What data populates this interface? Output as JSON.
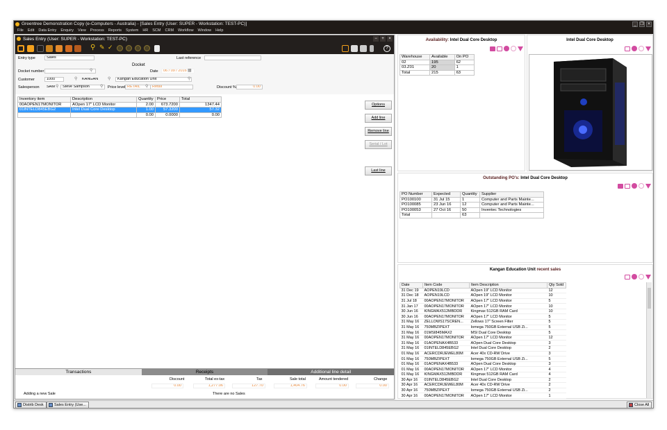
{
  "app": {
    "title": "Greentree Demonstration Copy (e-Computers - Australia) - [Sales Entry (User: SUPER - Workstation: TEST-PC)]"
  },
  "menu": [
    "File",
    "Edit",
    "Data Entry",
    "Enquiry",
    "View",
    "Process",
    "Reports",
    "System",
    "HR",
    "SCM",
    "CRM",
    "Workflow",
    "Window",
    "Help"
  ],
  "window": {
    "title": "Sales Entry (User: SUPER - Workstation: TEST-PC)"
  },
  "form": {
    "entry_type_label": "Entry type",
    "entry_type": "Sales",
    "last_ref_label": "Last reference",
    "docket_title": "Docket",
    "docket_number_label": "Docket number",
    "date_label": "Date",
    "date_value": "06 / 09 / 2016",
    "customer_label": "Customer",
    "customer_id": "1000",
    "customer_code": "KANGAN",
    "customer_name": "Kangan Education Unit",
    "salesperson_label": "Salesperson",
    "salesperson_code": "SAMF",
    "salesperson_name": "Steve Sampson",
    "price_level_label": "Price level",
    "price_level_code": "RETAIL",
    "price_level_name": "Retail",
    "discount_label": "Discount %",
    "discount_value": "0.00"
  },
  "lines": {
    "headers": [
      "Inventory item",
      "Description",
      "Quantity",
      "Price",
      "Total"
    ],
    "rows": [
      {
        "item": "00AOPEN17MONITOR",
        "desc": "AOpen 17\" LCD Monitor",
        "qty": "2.00",
        "price": "673.7200",
        "total": "1347.44"
      },
      {
        "item": "01INTELD845EBG2",
        "desc": "Intel Dual Core Desktop",
        "qty": "1.00",
        "price": "57.3200",
        "total": "57.32"
      },
      {
        "item": "",
        "desc": "",
        "qty": "0.00",
        "price": "0.0000",
        "total": "0.00"
      }
    ]
  },
  "side_buttons": {
    "options": "Options",
    "add_line": "Add line",
    "remove_line": "Remove line",
    "serial_lot": "Serial / Lot",
    "last_line": "Last line"
  },
  "tabs": {
    "transactions": "Transactions",
    "receipts": "Receipts",
    "additional": "Additional line detail"
  },
  "totals": {
    "discount_label": "Discount",
    "discount": "0.00",
    "total_extax_label": "Total ex-tax",
    "total_extax": "1,277.06",
    "tax_label": "Tax",
    "tax": "127.70",
    "sale_total_label": "Sale total",
    "sale_total": "1,404.76",
    "amount_tendered_label": "Amount tendered",
    "amount_tendered": "0.00",
    "change_label": "Change",
    "change": "0.00",
    "mode_text": "Adding a new Sale",
    "sales_text": "There are no Sales"
  },
  "availability": {
    "title_prefix": "Availability: ",
    "title_item": "Intel Dual Core Desktop",
    "headers": [
      "Warehouse",
      "Available",
      "On PO"
    ],
    "rows": [
      [
        "02",
        "195",
        "62"
      ],
      [
        "03.Z01",
        "20",
        "1"
      ],
      [
        "Total",
        "215",
        "63"
      ]
    ]
  },
  "image_panel": {
    "title": "Intel Dual Core Desktop"
  },
  "outstanding": {
    "title_prefix": "Outstanding PO's: ",
    "title_item": "Intel Dual Core Desktop",
    "headers": [
      "PO Number",
      "Expected",
      "Quantity",
      "Supplier"
    ],
    "rows": [
      [
        "PO100100",
        "31 Jul 15",
        "1",
        "Computer and Parts Mainte..."
      ],
      [
        "PO100085",
        "23 Jun 16",
        "12",
        "Computer and Parts Mainte..."
      ],
      [
        "PO100053",
        "27 Oct 16",
        "50",
        "Inventec Technologies"
      ],
      [
        "Total",
        "",
        "63",
        ""
      ]
    ]
  },
  "recent": {
    "title_name": "Kangan Education Unit",
    "title_suffix": " recent sales",
    "headers": [
      "Date",
      "Item Code",
      "Item Description",
      "Qty Sold"
    ],
    "rows": [
      [
        "31 Dec 19",
        "AOPEN19LCD",
        "AOpen 19\" LCD Monitor",
        "12"
      ],
      [
        "31 Dec 18",
        "AOPEN19LCD",
        "AOpen 19\" LCD Monitor",
        "10"
      ],
      [
        "31 Jul 18",
        "00AOPEN17MONITOR",
        "AOpen 17\" LCD Monitor",
        "5"
      ],
      [
        "31 Jan 17",
        "00AOPEN17MONITOR",
        "AOpen 17\" LCD Monitor",
        "10"
      ],
      [
        "30 Jun 16",
        "KINGMAX512MBDDR",
        "Kingmax 512GB RAM Card",
        "10"
      ],
      [
        "30 Jun 16",
        "00AOPEN17MONITOR",
        "AOpen 17\" LCD Monitor",
        "5"
      ],
      [
        "31 May 16",
        "ZELLOWS17SCREN...",
        "Zellows 17\" Screen Filter",
        "5"
      ],
      [
        "31 May 16",
        "750MBZIPEXT",
        "Iomega 750GB External USB Zi...",
        "5"
      ],
      [
        "31 May 16",
        "01MSI845MAX2",
        "MSI Dual Core Desktop",
        "5"
      ],
      [
        "31 May 16",
        "00AOPEN17MONITOR",
        "AOpen 17\" LCD Monitor",
        "12"
      ],
      [
        "31 May 16",
        "01AOPENAX4B533",
        "AOpen Dual Core Desktop",
        "3"
      ],
      [
        "31 May 16",
        "01INTELD845EBG2",
        "Intel Dual Core Desktop",
        "2"
      ],
      [
        "01 May 16",
        "ACERCDRJEWEL80M",
        "Acer 40x CD-RW Drive",
        "3"
      ],
      [
        "01 May 16",
        "750MBZIPEXT",
        "Iomega 750GB External USB Zi...",
        "5"
      ],
      [
        "01 May 16",
        "01AOPENAX4B533",
        "AOpen Dual Core Desktop",
        "3"
      ],
      [
        "01 May 16",
        "00AOPEN17MONITOR",
        "AOpen 17\" LCD Monitor",
        "4"
      ],
      [
        "01 May 16",
        "KINGMAX512MBDDR",
        "Kingmax 512GB RAM Card",
        "4"
      ],
      [
        "30 Apr 16",
        "01INTELD845EBG2",
        "Intel Dual Core Desktop",
        "2"
      ],
      [
        "30 Apr 16",
        "ACERCDRJEWEL80M",
        "Acer 40x CD-RW Drive",
        "2"
      ],
      [
        "30 Apr 16",
        "750MBZIPEXT",
        "Iomega 750GB External USB Zi...",
        "2"
      ],
      [
        "30 Apr 16",
        "00AOPEN17MONITOR",
        "AOpen 17\" LCD Monitor",
        "1"
      ]
    ]
  },
  "statusbar": {
    "distrib": "Distrib Desk",
    "sales_entry": "Sales Entry (Use...",
    "close_all": "Close All"
  },
  "colors": {
    "accent": "#d24ba0",
    "selection": "#3399ff",
    "titlebar": "#1f1a17",
    "orange_text": "#e8893b"
  }
}
